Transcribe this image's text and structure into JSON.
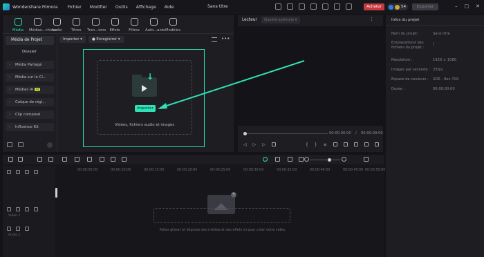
{
  "titlebar": {
    "app_name": "Wondershare Filmora",
    "menu": [
      "Fichier",
      "Modifier",
      "Outils",
      "Affichage",
      "Aide"
    ],
    "doc_title": "Sans titre",
    "buy_label": "Acheter",
    "credits": "54",
    "export_label": "Exporter"
  },
  "media": {
    "tools": [
      {
        "label": "Média",
        "icon": "media-icon"
      },
      {
        "label": "Médias...chives",
        "icon": "stock-media-icon"
      },
      {
        "label": "Audio",
        "icon": "audio-icon"
      },
      {
        "label": "Titres",
        "icon": "titles-icon"
      },
      {
        "label": "Tran...ions",
        "icon": "transitions-icon"
      },
      {
        "label": "Effets",
        "icon": "effects-icon"
      },
      {
        "label": "Filtres",
        "icon": "filters-icon"
      },
      {
        "label": "Auto...ants",
        "icon": "stickers-icon"
      },
      {
        "label": "Modèles",
        "icon": "templates-icon"
      }
    ],
    "sidebar": {
      "head": "Média de Projet",
      "sub": "Dossier",
      "items": [
        "Média Partagé",
        "Média sur le Cl...",
        "Médias IA",
        "Calque de régl...",
        "Clip composé",
        "Influence Kit"
      ],
      "ai_tag": "AI"
    },
    "import_dropdown": "Importer",
    "record_dropdown": "Enregistrer",
    "import_button": "Importer",
    "drop_text": "Vidéos, fichiers audio et images"
  },
  "player": {
    "tab": "Lecteur",
    "quality": "Qualité optimale",
    "time_current": "00:00:00:00",
    "time_total": "00:00:00:00"
  },
  "info": {
    "title": "Infos du projet",
    "rows": [
      {
        "label": "Nom du projet :",
        "value": "Sans titre"
      },
      {
        "label": "Emplacement des fichiers du projet :",
        "value": "/"
      },
      {
        "label": "Résolution :",
        "value": "1920 × 1080"
      },
      {
        "label": "Images par seconde :",
        "value": "25fps"
      },
      {
        "label": "Espace de couleurs :",
        "value": "SDR - Rec.709"
      },
      {
        "label": "Durée :",
        "value": "00:00:00:00"
      }
    ]
  },
  "timeline": {
    "ticks": [
      "00:00:05:00",
      "00:00:10:00",
      "00:00:15:00",
      "00:00:20:00",
      "00:00:25:00",
      "00:00:30:00",
      "00:00:35:00",
      "00:00:40:00",
      "00:00:45:00",
      "00:00:50:00"
    ],
    "video_track": "Vidéo 1",
    "audio_track": "Audio 1",
    "hint": "Faites glisser et déposez des médias et des effets ici pour créer votre vidéo."
  },
  "colors": {
    "accent": "#2fe1b6",
    "buy": "#c43a3f",
    "bg": "#141418",
    "panel": "#1d1d22"
  }
}
